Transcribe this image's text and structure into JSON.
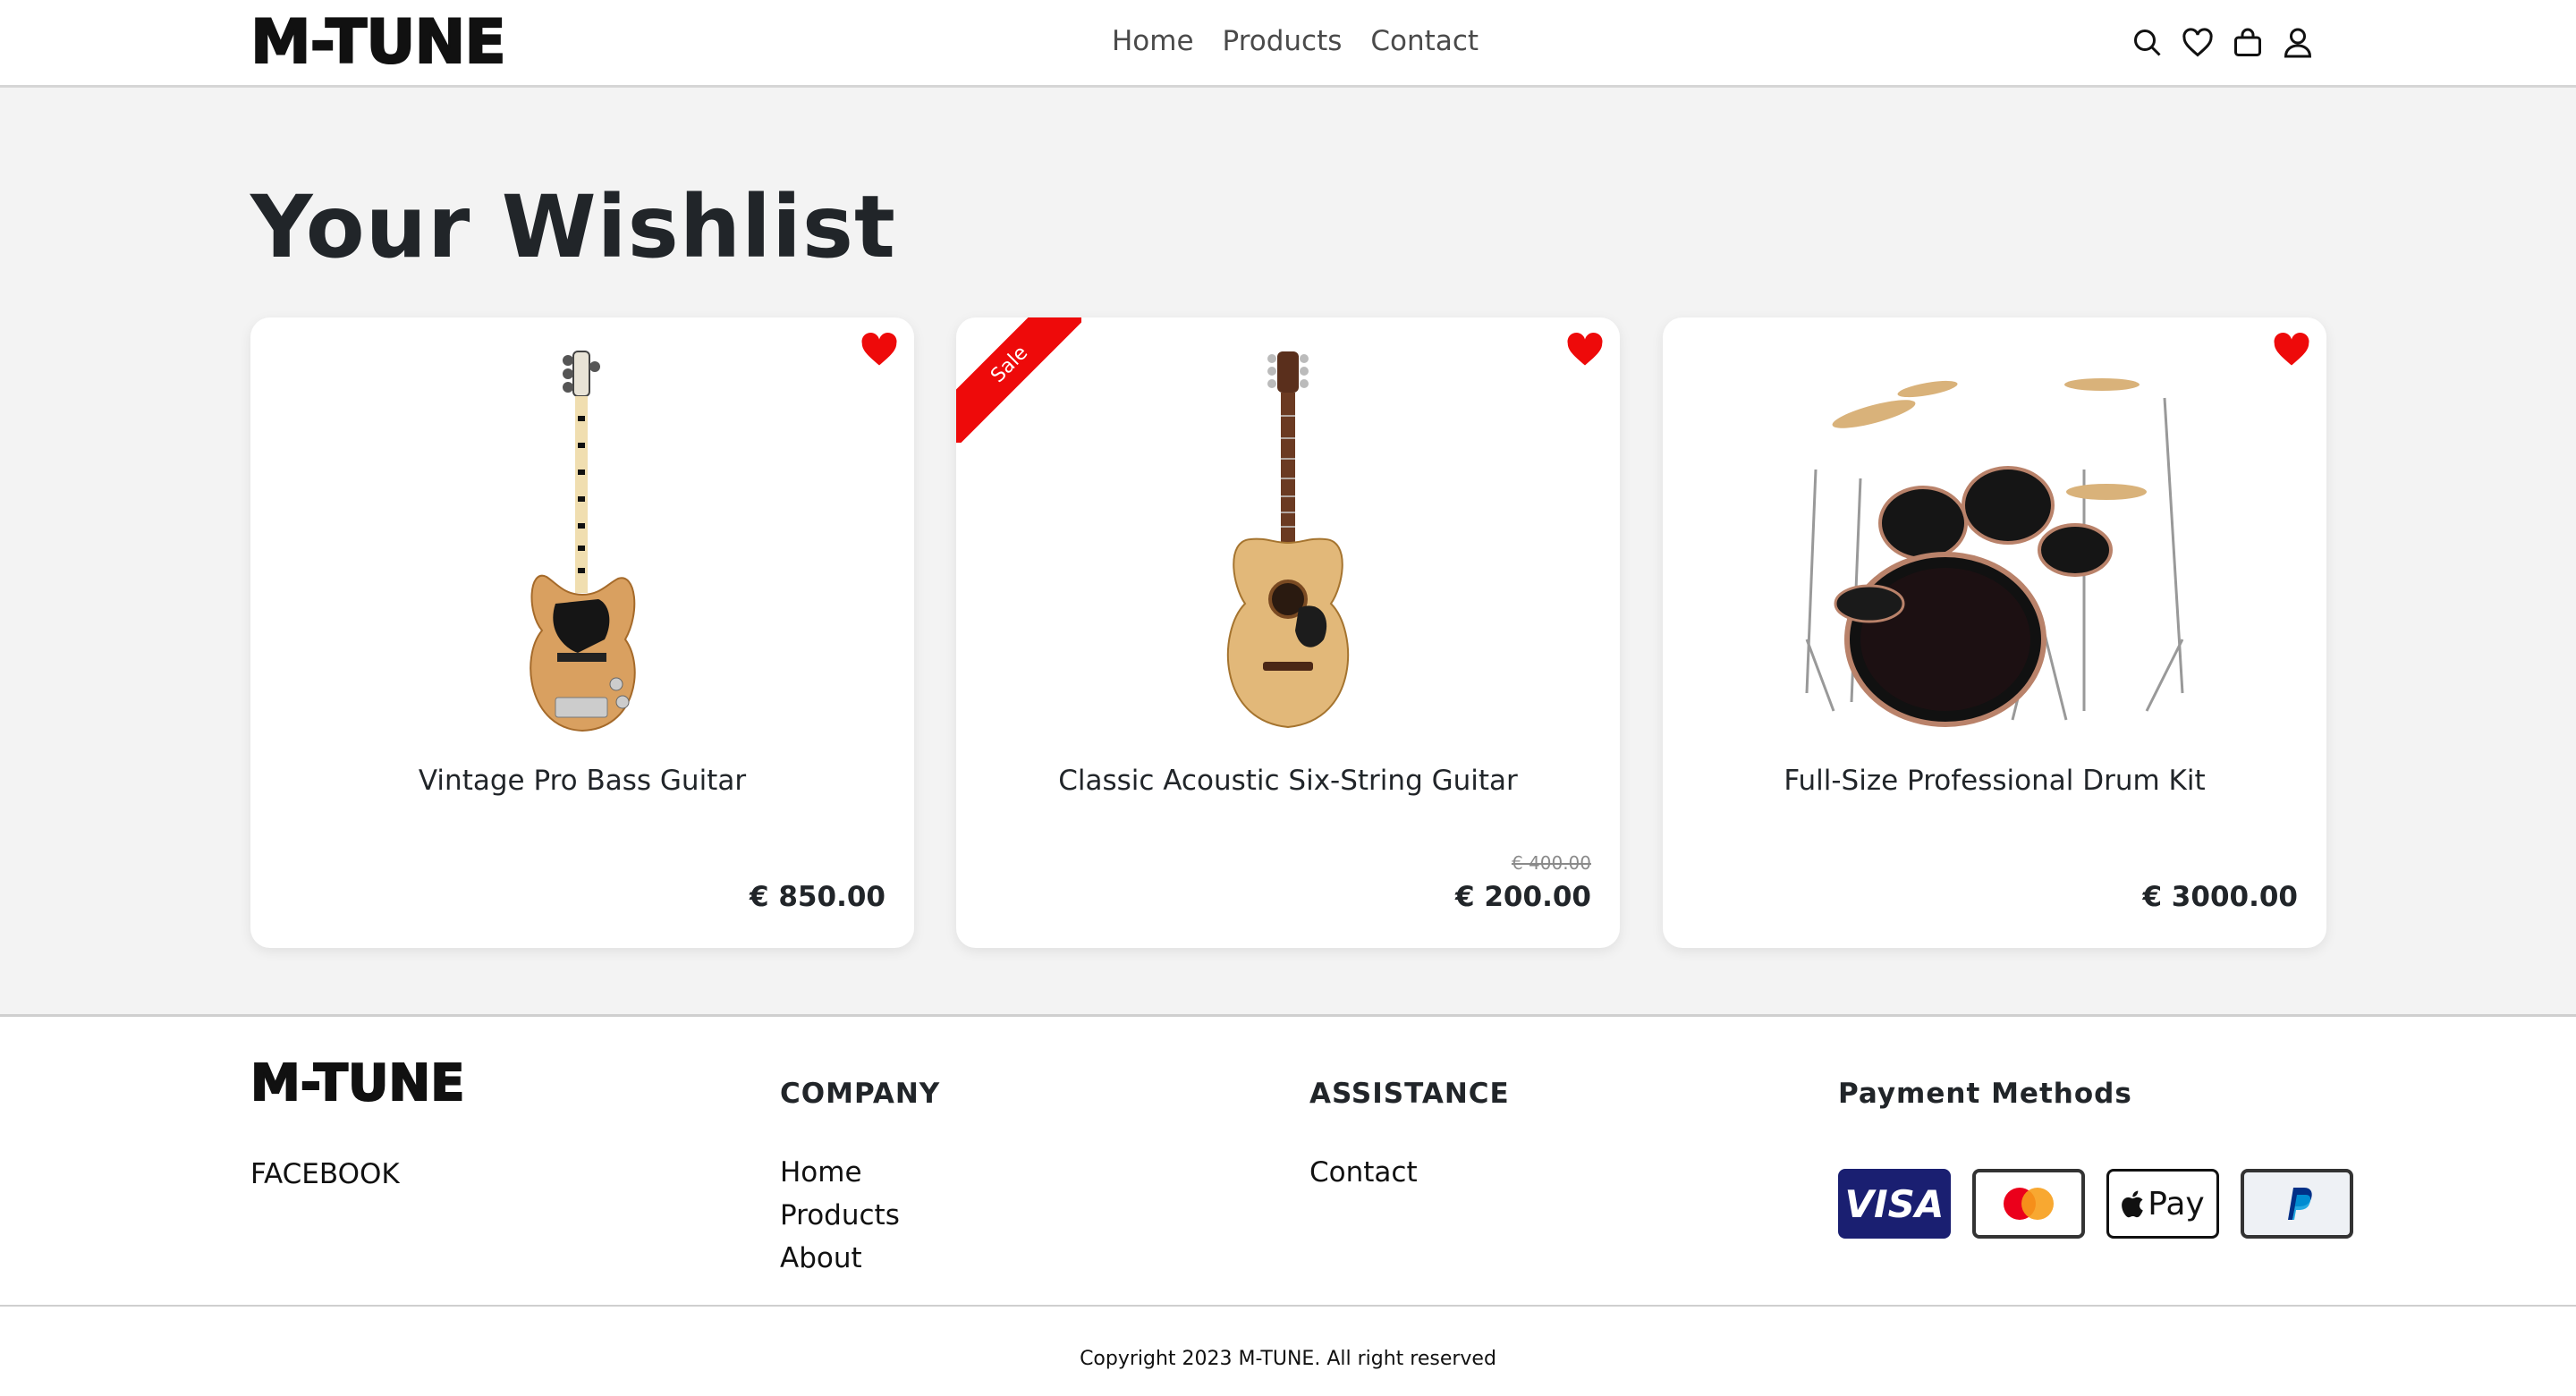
{
  "header": {
    "logo": "M-TUNE",
    "nav": [
      "Home",
      "Products",
      "Contact"
    ],
    "icons": [
      "search-icon",
      "heart-icon",
      "shopping-bag-icon",
      "user-icon"
    ]
  },
  "main": {
    "title": "Your Wishlist",
    "products": [
      {
        "name": "Vintage Pro Bass Guitar",
        "price": "€ 850.00",
        "old_price": "",
        "sale": false,
        "image": "bass-guitar-image"
      },
      {
        "name": "Classic Acoustic Six-String Guitar",
        "price": "€ 200.00",
        "old_price": "€ 400.00",
        "sale": true,
        "sale_label": "Sale",
        "image": "acoustic-guitar-image"
      },
      {
        "name": "Full-Size Professional Drum Kit",
        "price": "€ 3000.00",
        "old_price": "",
        "sale": false,
        "image": "drum-kit-image"
      }
    ],
    "colors": {
      "heart": "#ee0a0a",
      "ribbon": "#ee0a0a",
      "background": "#f3f3f3"
    }
  },
  "footer": {
    "logo": "M-TUNE",
    "social": "FACEBOOK",
    "company": {
      "heading": "COMPANY",
      "links": [
        "Home",
        "Products",
        "About"
      ]
    },
    "assistance": {
      "heading": "ASSISTANCE",
      "links": [
        "Contact"
      ]
    },
    "payment": {
      "heading": "Payment Methods",
      "visa": "VISA",
      "apple_pay": "Pay",
      "methods": [
        "visa-icon",
        "mastercard-icon",
        "apple-pay-icon",
        "paypal-icon"
      ]
    },
    "copyright": "Copyright 2023 M-TUNE. All right reserved"
  }
}
